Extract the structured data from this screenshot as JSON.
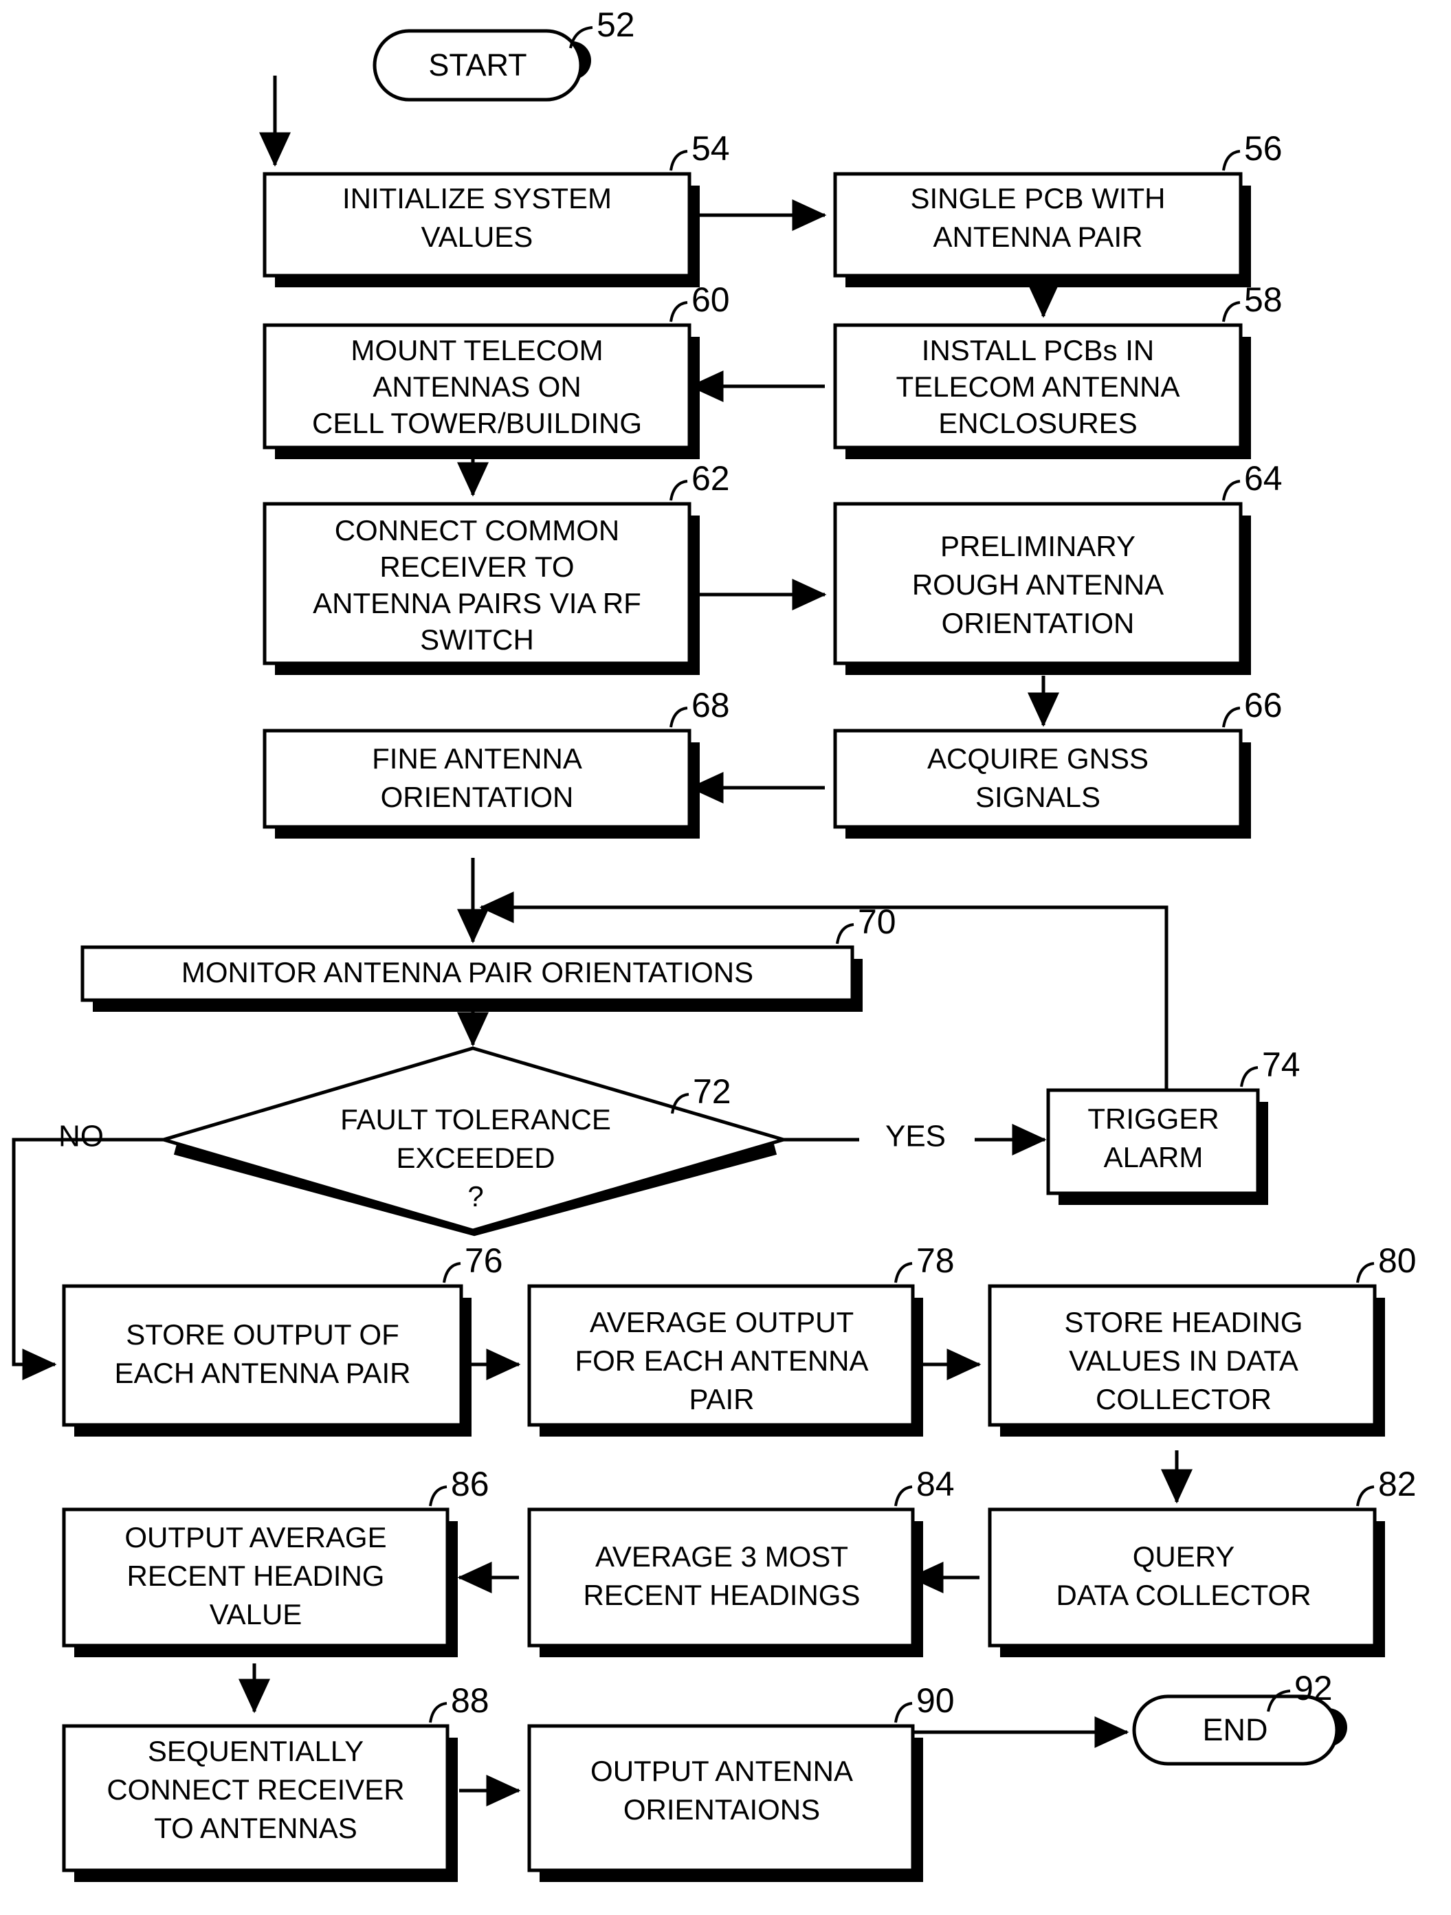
{
  "diagram": {
    "title": "Antenna Orientation Monitoring Process Flowchart",
    "background_color": "#ffffff",
    "line_color": "#000000",
    "fill_color": "#ffffff"
  },
  "nodes": {
    "start": {
      "ref": "52",
      "label": "START",
      "shape": "terminator"
    },
    "n54": {
      "ref": "54",
      "label": [
        "INITIALIZE SYSTEM",
        "VALUES"
      ],
      "shape": "process"
    },
    "n56": {
      "ref": "56",
      "label": [
        "SINGLE PCB WITH",
        "ANTENNA PAIR"
      ],
      "shape": "process"
    },
    "n58": {
      "ref": "58",
      "label": [
        "INSTALL PCBs IN",
        "TELECOM ANTENNA",
        "ENCLOSURES"
      ],
      "shape": "process"
    },
    "n60": {
      "ref": "60",
      "label": [
        "MOUNT TELECOM",
        "ANTENNAS ON",
        "CELL TOWER/BUILDING"
      ],
      "shape": "process"
    },
    "n62": {
      "ref": "62",
      "label": [
        "CONNECT COMMON",
        "RECEIVER TO",
        "ANTENNA PAIRS VIA RF",
        "SWITCH"
      ],
      "shape": "process"
    },
    "n64": {
      "ref": "64",
      "label": [
        "PRELIMINARY",
        "ROUGH ANTENNA",
        "ORIENTATION"
      ],
      "shape": "process"
    },
    "n66": {
      "ref": "66",
      "label": [
        "ACQUIRE GNSS",
        "SIGNALS"
      ],
      "shape": "process"
    },
    "n68": {
      "ref": "68",
      "label": [
        "FINE ANTENNA",
        "ORIENTATION"
      ],
      "shape": "process"
    },
    "n70": {
      "ref": "70",
      "label": [
        "MONITOR ANTENNA PAIR ORIENTATIONS"
      ],
      "shape": "process"
    },
    "n72": {
      "ref": "72",
      "label": [
        "FAULT TOLERANCE",
        "EXCEEDED",
        "?"
      ],
      "shape": "decision"
    },
    "n74": {
      "ref": "74",
      "label": [
        "TRIGGER",
        "ALARM"
      ],
      "shape": "process"
    },
    "n76": {
      "ref": "76",
      "label": [
        "STORE OUTPUT OF",
        "EACH ANTENNA PAIR"
      ],
      "shape": "process"
    },
    "n78": {
      "ref": "78",
      "label": [
        "AVERAGE OUTPUT",
        "FOR EACH ANTENNA",
        "PAIR"
      ],
      "shape": "process"
    },
    "n80": {
      "ref": "80",
      "label": [
        "STORE HEADING",
        "VALUES IN DATA",
        "COLLECTOR"
      ],
      "shape": "process"
    },
    "n82": {
      "ref": "82",
      "label": [
        "QUERY",
        "DATA COLLECTOR"
      ],
      "shape": "process"
    },
    "n84": {
      "ref": "84",
      "label": [
        "AVERAGE 3 MOST",
        "RECENT HEADINGS"
      ],
      "shape": "process"
    },
    "n86": {
      "ref": "86",
      "label": [
        "OUTPUT AVERAGE",
        "RECENT HEADING",
        "VALUE"
      ],
      "shape": "process"
    },
    "n88": {
      "ref": "88",
      "label": [
        "SEQUENTIALLY",
        "CONNECT RECEIVER",
        "TO ANTENNAS"
      ],
      "shape": "process"
    },
    "n90": {
      "ref": "90",
      "label": [
        "OUTPUT ANTENNA",
        "ORIENTAIONS"
      ],
      "shape": "process"
    },
    "end": {
      "ref": "92",
      "label": "END",
      "shape": "terminator"
    }
  },
  "edge_labels": {
    "no": "NO",
    "yes": "YES"
  },
  "ref_numbers": [
    "52",
    "54",
    "56",
    "58",
    "60",
    "62",
    "64",
    "66",
    "68",
    "70",
    "72",
    "74",
    "76",
    "78",
    "80",
    "82",
    "84",
    "86",
    "88",
    "90",
    "92"
  ]
}
